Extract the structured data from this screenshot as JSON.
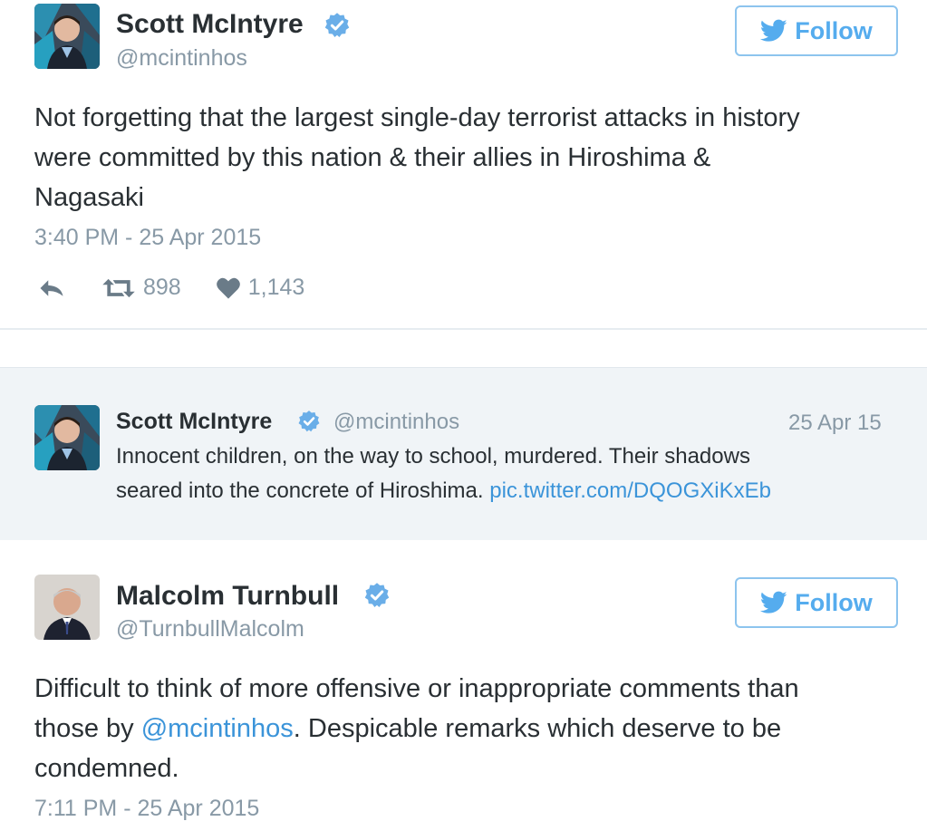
{
  "tweet1": {
    "name": "Scott McIntyre",
    "handle": "@mcintinhos",
    "follow_label": "Follow",
    "text_lines": [
      "Not forgetting that the largest single-day terrorist attacks in history",
      "were committed by this nation & their allies in Hiroshima &",
      "Nagasaki"
    ],
    "timestamp": "3:40 PM - 25 Apr 2015",
    "retweets": "898",
    "likes": "1,143"
  },
  "quoted": {
    "name": "Scott McIntyre",
    "handle": "@mcintinhos",
    "date": "25 Apr 15",
    "text_line1": "Innocent children, on the way to school, murdered. Their shadows",
    "text_line2": "seared into the concrete of Hiroshima.",
    "link": "pic.twitter.com/DQOGXiKxEb"
  },
  "tweet2": {
    "name": "Malcolm Turnbull",
    "handle": "@TurnbullMalcolm",
    "follow_label": "Follow",
    "text_pre": "Difficult to think of more offensive or inappropriate comments than",
    "text_line2_pre": "those by",
    "mention": "@mcintinhos",
    "text_line2_post": ". Despicable remarks which deserve to be",
    "text_line3": "condemned.",
    "timestamp": "7:11 PM - 25 Apr 2015"
  },
  "icons": {
    "verified": "verified-badge-icon",
    "bird": "twitter-bird-icon",
    "reply": "reply-icon",
    "retweet": "retweet-icon",
    "like": "heart-icon"
  },
  "colors": {
    "brand_blue": "#55acee",
    "verified_blue": "#6aaee8",
    "link_blue": "#3b94d9",
    "muted": "#8899a6",
    "quote_bg": "#f0f4f7"
  }
}
